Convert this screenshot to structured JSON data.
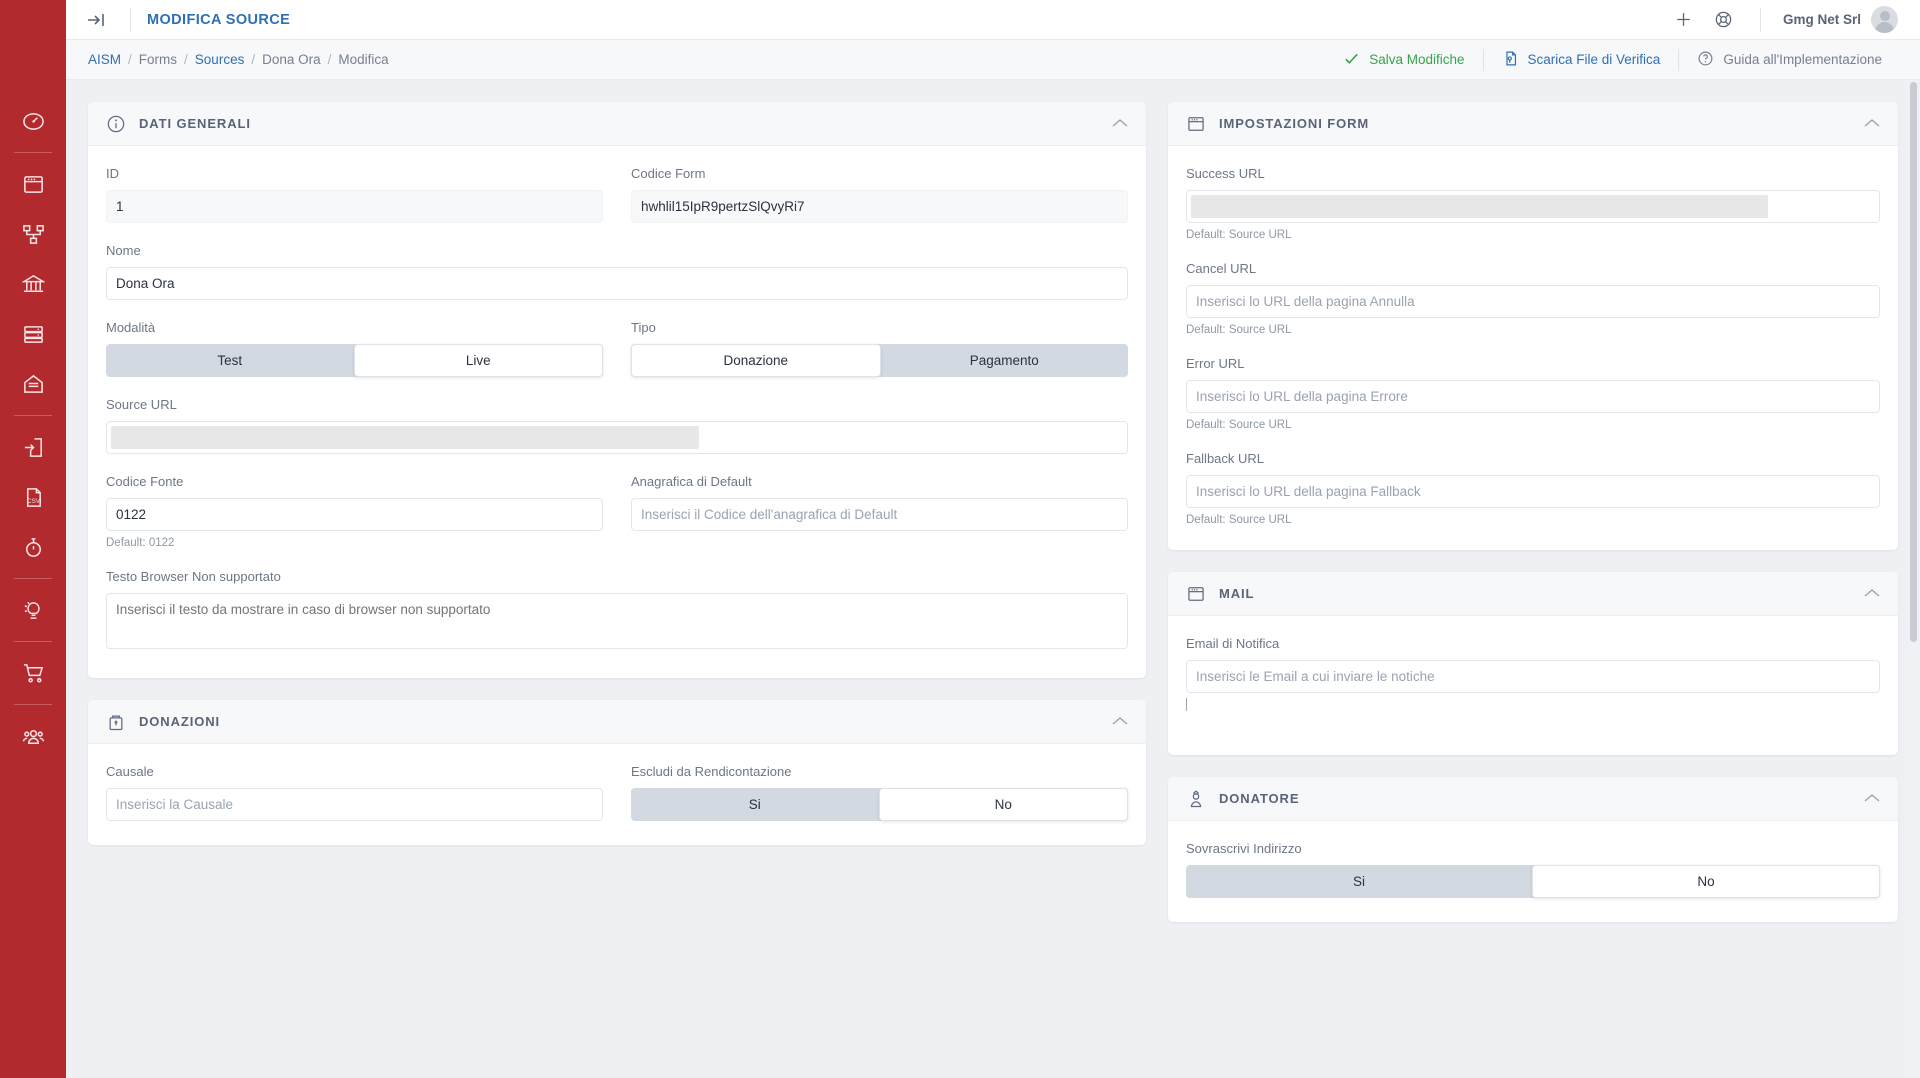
{
  "brand": {
    "accent": "#b2292e",
    "link": "#2f6fb5",
    "save": "#38a34a"
  },
  "sidebar": {
    "items": [
      {
        "name": "dashboard",
        "icon": "gauge-icon"
      },
      {
        "name": "forms",
        "icon": "window-icon"
      },
      {
        "name": "flows",
        "icon": "sitemap-icon"
      },
      {
        "name": "banks",
        "icon": "bank-icon"
      },
      {
        "name": "database",
        "icon": "server-icon"
      },
      {
        "name": "mail",
        "icon": "envelope-open-icon"
      },
      {
        "name": "import",
        "icon": "file-import-icon"
      },
      {
        "name": "csv",
        "icon": "file-csv-icon"
      },
      {
        "name": "scheduler",
        "icon": "stopwatch-icon"
      },
      {
        "name": "insights",
        "icon": "lightbulb-icon"
      },
      {
        "name": "shop",
        "icon": "cart-icon"
      },
      {
        "name": "users",
        "icon": "users-icon"
      }
    ]
  },
  "topbar": {
    "collapse_icon": "collapse-panel-icon",
    "title": "MODIFICA SOURCE",
    "add_icon": "plus-icon",
    "support_icon": "lifebuoy-icon",
    "user": "Gmg Net Srl",
    "avatar_icon": "avatar"
  },
  "breadcrumb": [
    {
      "label": "AISM",
      "link": true
    },
    {
      "label": "Forms",
      "link": false
    },
    {
      "label": "Sources",
      "link": true
    },
    {
      "label": "Dona Ora",
      "link": false
    },
    {
      "label": "Modifica",
      "link": false
    }
  ],
  "actions": [
    {
      "label": "Salva Modifiche",
      "icon": "check-icon",
      "style": "save"
    },
    {
      "label": "Scarica File di Verifica",
      "icon": "file-download-icon",
      "style": "dl"
    },
    {
      "label": "Guida all'Implementazione",
      "icon": "question-circle-icon",
      "style": "guide"
    }
  ],
  "panels": {
    "dati_generali": {
      "title": "DATI GENERALI",
      "icon": "info-circle-icon",
      "chevron": "chevron-up-icon",
      "fields": {
        "id": {
          "label": "ID",
          "value": "1",
          "readonly": true
        },
        "codice_form": {
          "label": "Codice Form",
          "value": "hwhlil15IpR9pertzSlQvyRi7",
          "readonly": true
        },
        "nome": {
          "label": "Nome",
          "value": "Dona Ora"
        },
        "modalita": {
          "label": "Modalità",
          "options": [
            "Test",
            "Live"
          ],
          "selected": "Live"
        },
        "tipo": {
          "label": "Tipo",
          "options": [
            "Donazione",
            "Pagamento"
          ],
          "selected": "Donazione"
        },
        "source_url": {
          "label": "Source URL",
          "value": "",
          "redacted": true
        },
        "codice_fonte": {
          "label": "Codice Fonte",
          "value": "0122",
          "hint": "Default: 0122"
        },
        "anagrafica": {
          "label": "Anagrafica di Default",
          "placeholder": "Inserisci il Codice dell'anagrafica di Default"
        },
        "testo_browser": {
          "label": "Testo Browser Non supportato",
          "placeholder": "Inserisci il testo da mostrare in caso di browser non supportato"
        }
      }
    },
    "donazioni": {
      "title": "DONAZIONI",
      "icon": "donation-box-icon",
      "chevron": "chevron-up-icon",
      "fields": {
        "causale": {
          "label": "Causale",
          "placeholder": "Inserisci la Causale"
        },
        "escludi": {
          "label": "Escludi da Rendicontazione",
          "options": [
            "Si",
            "No"
          ],
          "selected": "No"
        }
      }
    },
    "impostazioni_form": {
      "title": "IMPOSTAZIONI FORM",
      "icon": "window-icon",
      "chevron": "chevron-up-icon",
      "fields": {
        "success_url": {
          "label": "Success URL",
          "value": "",
          "redacted": true,
          "hint": "Default: Source URL"
        },
        "cancel_url": {
          "label": "Cancel URL",
          "placeholder": "Inserisci lo URL della pagina Annulla",
          "hint": "Default: Source URL"
        },
        "error_url": {
          "label": "Error URL",
          "placeholder": "Inserisci lo URL della pagina Errore",
          "hint": "Default: Source URL"
        },
        "fallback_url": {
          "label": "Fallback URL",
          "placeholder": "Inserisci lo URL della pagina Fallback",
          "hint": "Default: Source URL"
        }
      }
    },
    "mail": {
      "title": "MAIL",
      "icon": "window-icon",
      "chevron": "chevron-up-icon",
      "fields": {
        "email_notifica": {
          "label": "Email di Notifica",
          "placeholder": "Inserisci le Email a cui inviare le notiche"
        }
      }
    },
    "donatore": {
      "title": "DONATORE",
      "icon": "donor-icon",
      "chevron": "chevron-up-icon",
      "fields": {
        "sovrascrivi": {
          "label": "Sovrascrivi Indirizzo",
          "options": [
            "Si",
            "No"
          ],
          "selected": "Si"
        }
      }
    }
  }
}
